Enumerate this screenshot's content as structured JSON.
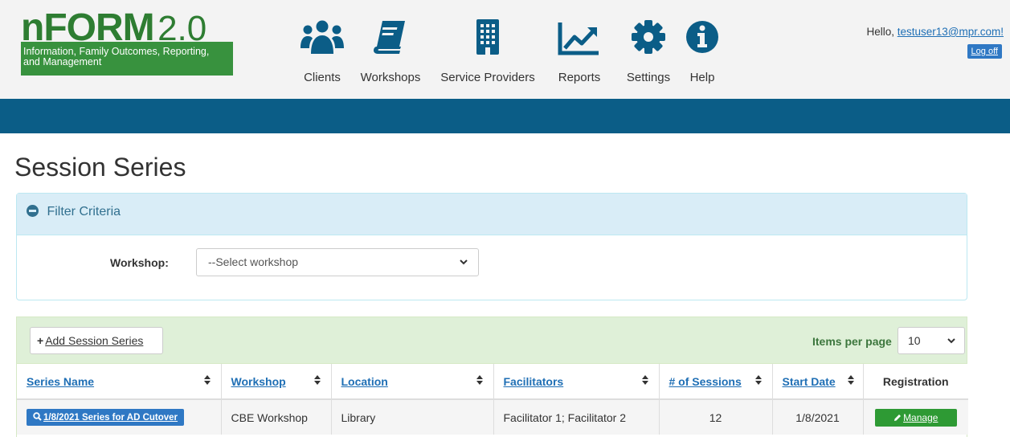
{
  "logo": {
    "brand": "nFORM",
    "version": "2.0",
    "tagline_line1": "Information, Family Outcomes, Reporting,",
    "tagline_line2": "and Management"
  },
  "nav": [
    {
      "label": "Clients",
      "icon": "users-icon"
    },
    {
      "label": "Workshops",
      "icon": "book-icon"
    },
    {
      "label": "Service Providers",
      "icon": "building-icon"
    },
    {
      "label": "Reports",
      "icon": "chart-line-icon"
    },
    {
      "label": "Settings",
      "icon": "gear-icon"
    },
    {
      "label": "Help",
      "icon": "info-icon"
    }
  ],
  "user": {
    "greeting": "Hello,",
    "email": "testuser13@mpr.com!",
    "logoff": "Log off"
  },
  "page": {
    "title": "Session Series"
  },
  "filter": {
    "heading": "Filter Criteria",
    "workshop_label": "Workshop:",
    "workshop_value": "--Select workshop"
  },
  "results": {
    "add_button": "Add Session Series",
    "items_per_page_label": "Items per page",
    "items_per_page_value": "10",
    "columns": [
      "Series Name",
      "Workshop",
      "Location",
      "Facilitators",
      "# of Sessions",
      "Start Date",
      "Registration"
    ],
    "rows": [
      {
        "series_name": "1/8/2021 Series for AD Cutover",
        "workshop": "CBE Workshop",
        "location": "Library",
        "facilitators": "Facilitator 1; Facilitator 2",
        "sessions": "12",
        "start_date": "1/8/2021",
        "registration": "Manage"
      }
    ]
  },
  "colors": {
    "brand_green": "#38923e",
    "nav_bar": "#0b5d87",
    "link_blue": "#1f6fb5",
    "filter_bg": "#d9edf7",
    "results_bg": "#dff0d8"
  }
}
